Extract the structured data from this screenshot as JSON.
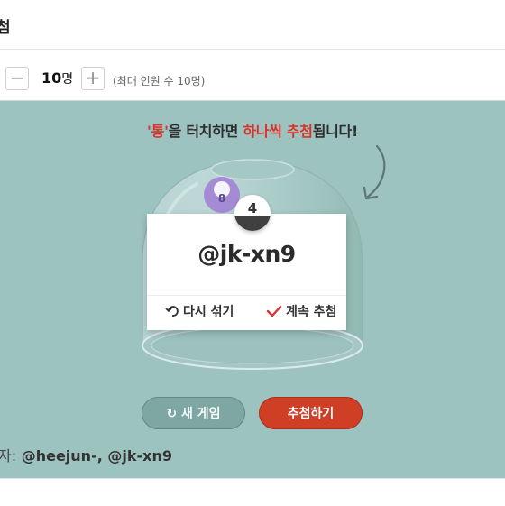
{
  "header": {
    "title": "첨"
  },
  "participants": {
    "minus_label": "−",
    "plus_label": "+",
    "count": "10",
    "unit": "명",
    "max_hint": "(최대 인원 수 10명)"
  },
  "instruction": {
    "quote_open": "'",
    "keyword": "통",
    "quote_close": "'",
    "part1": "을 터치하면 ",
    "highlight": "하나씩 추첨",
    "part2": "됩니다!"
  },
  "dome": {
    "visible_ball_number": "8"
  },
  "result_card": {
    "winner_ball_number": "4",
    "winner_name": "@jk-xn9",
    "reshuffle_label": "다시 섞기",
    "continue_label": "계속 추첨"
  },
  "buttons": {
    "new_game_label": "새 게임",
    "draw_label": "추첨하기"
  },
  "winners": {
    "prefix": "자:",
    "list": "@heejun-, @jk-xn9"
  },
  "colors": {
    "stage_bg": "#9dc3c1",
    "accent_red": "#d9342b",
    "draw_button": "#cf3f26",
    "new_game_button": "#7ea6a3",
    "ball_purple": "#a58ad6"
  }
}
